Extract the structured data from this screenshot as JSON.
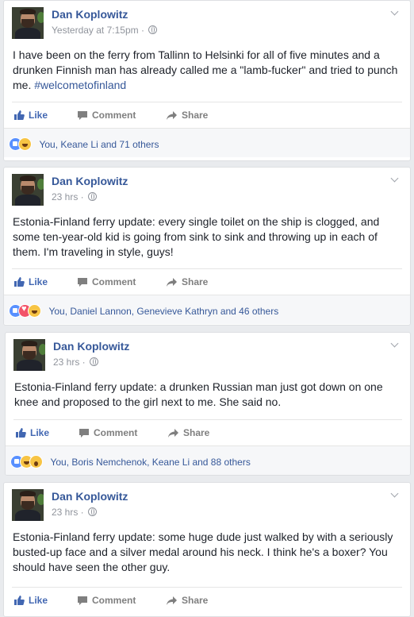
{
  "posts": [
    {
      "author": "Dan Koplowitz",
      "time": "Yesterday at 7:15pm ·",
      "text": "I have been on the ferry from Tallinn to Helsinki for all of five minutes and a drunken Finnish man has already called me a \"lamb-fucker\" and tried to punch me. ",
      "hashtag": "#welcometofinland",
      "actions": {
        "like": "Like",
        "comment": "Comment",
        "share": "Share"
      },
      "reactions": [
        "like",
        "haha"
      ],
      "reaction_summary": "You, Keane Li and 71 others"
    },
    {
      "author": "Dan Koplowitz",
      "time": "23 hrs ·",
      "text": "Estonia-Finland ferry update: every single toilet on the ship is clogged, and some ten-year-old kid is going from sink to sink and throwing up in each of them. I'm traveling in style, guys!",
      "actions": {
        "like": "Like",
        "comment": "Comment",
        "share": "Share"
      },
      "reactions": [
        "like",
        "love",
        "haha"
      ],
      "reaction_summary": "You, Daniel Lannon, Genevieve Kathryn and 46 others"
    },
    {
      "author": "Dan Koplowitz",
      "time": "23 hrs ·",
      "text": "Estonia-Finland ferry update: a drunken Russian man just got down on one knee and proposed to the girl next to me. She said no.",
      "actions": {
        "like": "Like",
        "comment": "Comment",
        "share": "Share"
      },
      "reactions": [
        "like",
        "haha",
        "wow"
      ],
      "reaction_summary": "You, Boris Nemchenok, Keane Li and 88 others"
    },
    {
      "author": "Dan Koplowitz",
      "time": "23 hrs ·",
      "text": "Estonia-Finland ferry update: some huge dude just walked by with a seriously busted-up face and a silver medal around his neck. I think he's a boxer? You should have seen the other guy.",
      "actions": {
        "like": "Like",
        "comment": "Comment",
        "share": "Share"
      }
    }
  ],
  "colors": {
    "link": "#365899",
    "like_blue": "#4267b2",
    "muted": "#90949c",
    "background": "#e9ebee"
  }
}
